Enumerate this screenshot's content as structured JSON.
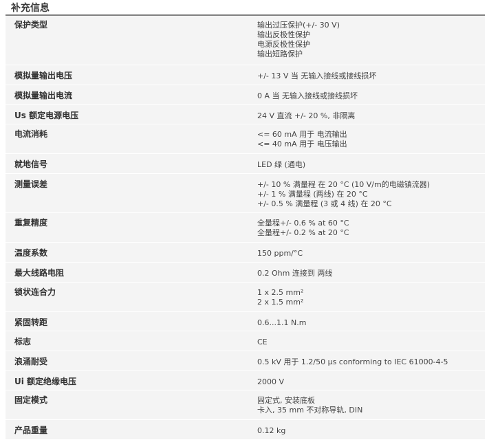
{
  "section_title": "补充信息",
  "rows": [
    {
      "label": "保护类型",
      "values": [
        "输出过压保护(+/- 30 V)",
        "输出反极性保护",
        "电源反极性保护",
        "输出短路保护"
      ]
    },
    {
      "label": "模拟量输出电压",
      "values": [
        "+/- 13 V 当 无输入接线或接线损坏"
      ]
    },
    {
      "label": "模拟量输出电流",
      "values": [
        "0 A 当 无输入接线或接线损坏"
      ]
    },
    {
      "label": "Us 额定电源电压",
      "values": [
        "24 V 直流 +/- 20 %, 非隔离"
      ]
    },
    {
      "label": "电流消耗",
      "values": [
        "<= 60 mA 用于 电流输出",
        "<= 40 mA 用于 电压输出"
      ]
    },
    {
      "label": "就地信号",
      "values": [
        "LED 绿 (通电)"
      ]
    },
    {
      "label": "测量误差",
      "values": [
        "+/- 10 % 满量程 在 20 °C (10 V/m的电磁镇流器)",
        "+/- 1 % 满量程 (两线) 在 20 °C",
        "+/- 0.5 % 满量程 (3 或 4 线) 在 20 °C"
      ]
    },
    {
      "label": "重复精度",
      "values": [
        "全量程+/- 0.6 % at 60 °C",
        "全量程+/- 0.2 % at 20 °C"
      ]
    },
    {
      "label": "温度系数",
      "values": [
        "150 ppm/°C"
      ]
    },
    {
      "label": "最大线路电阻",
      "values": [
        "0.2 Ohm 连接到 两线"
      ]
    },
    {
      "label": "锁状连合力",
      "values": [
        "1 x 2.5 mm²",
        "2 x 1.5 mm²"
      ]
    },
    {
      "label": "紧固转距",
      "values": [
        "0.6...1.1 N.m"
      ]
    },
    {
      "label": "标志",
      "values": [
        "CE"
      ]
    },
    {
      "label": "浪涌耐受",
      "values": [
        "0.5 kV 用于 1.2/50 µs conforming to IEC 61000-4-5"
      ]
    },
    {
      "label": "Ui 额定绝缘电压",
      "values": [
        "2000 V"
      ]
    },
    {
      "label": "固定模式",
      "values": [
        "固定式, 安装底板",
        "卡入, 35 mm 不对称导轨, DIN"
      ]
    },
    {
      "label": "产品重量",
      "values": [
        "0.12 kg"
      ]
    }
  ]
}
